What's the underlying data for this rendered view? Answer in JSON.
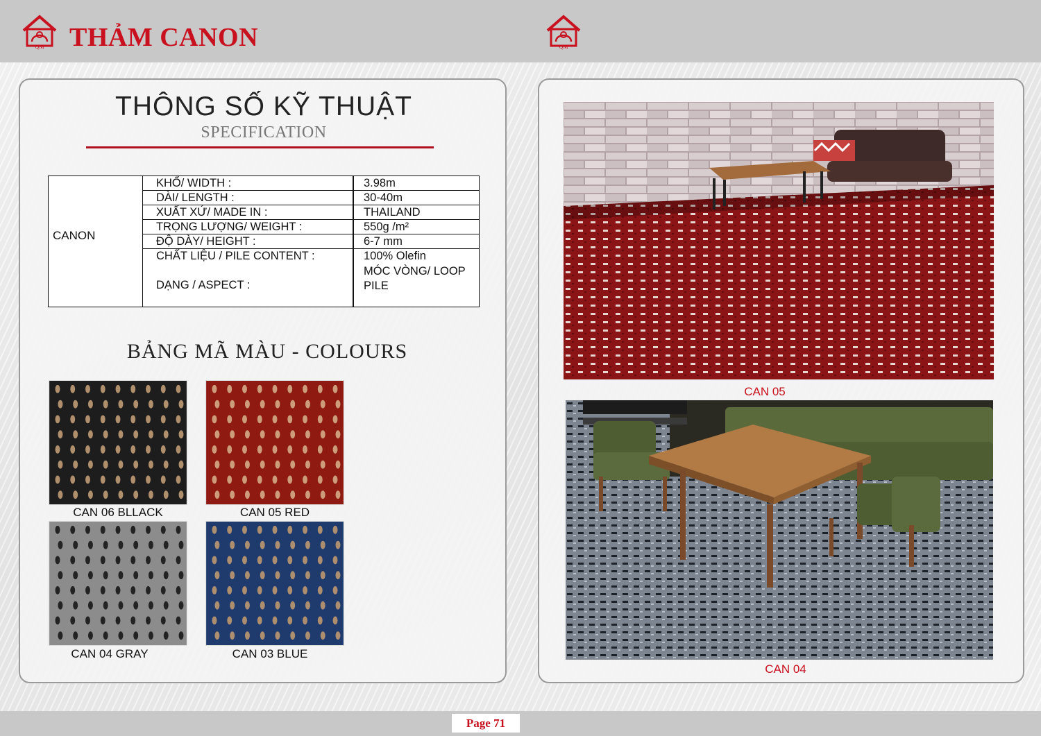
{
  "header": {
    "brand_title": "THẢM CANON",
    "logo_initials": "QM"
  },
  "colors": {
    "brand_red": "#c8101e",
    "bar_gray": "#c8c8c8"
  },
  "spec": {
    "title": "THÔNG SỐ KỸ THUẬT",
    "subtitle": "SPECIFICATION",
    "product_name": "CANON",
    "rows": [
      {
        "label": "KHỔ/ WIDTH :",
        "value": "3.98m"
      },
      {
        "label": "DÀI/ LENGTH :",
        "value": "30-40m"
      },
      {
        "label": "XUẤT XỨ/ MADE IN :",
        "value": "THAILAND"
      },
      {
        "label": "TRỌNG LƯỢNG/ WEIGHT :",
        "value": "550g /m²"
      },
      {
        "label": "ĐỘ DÀY/ HEIGHT :",
        "value": "6-7 mm"
      },
      {
        "label": "CHẤT LIỆU / PILE CONTENT :",
        "value": "100% Olefin"
      },
      {
        "label": "DẠNG / ASPECT :",
        "value": "MÓC VÒNG/ LOOP PILE"
      }
    ]
  },
  "colours": {
    "title": "BẢNG MÃ MÀU - COLOURS",
    "swatches": [
      {
        "label": "CAN 06 BLLACK",
        "base": "#1d1d1d",
        "fleck": "#c9a37a"
      },
      {
        "label": "CAN 05 RED",
        "base": "#8e1a12",
        "fleck": "#d7b48e"
      },
      {
        "label": "CAN 04 GRAY",
        "base": "#8c8c8c",
        "fleck": "#111111"
      },
      {
        "label": "CAN 03 BLUE",
        "base": "#1f3b6e",
        "fleck": "#c79d6f"
      }
    ]
  },
  "photos": [
    {
      "label": "CAN 05"
    },
    {
      "label": "CAN 04"
    }
  ],
  "footer": {
    "page_label": "Page 71"
  }
}
